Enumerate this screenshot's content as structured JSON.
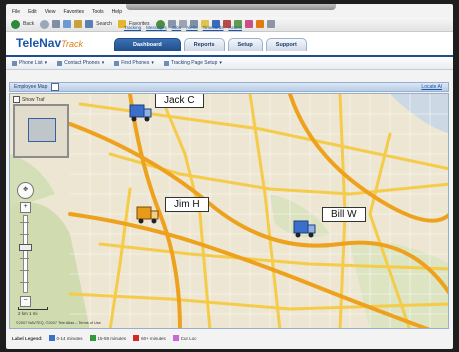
{
  "browser": {
    "menu": [
      "File",
      "Edit",
      "View",
      "Favorites",
      "Tools",
      "Help"
    ],
    "back_label": "Back",
    "search_label": "Search",
    "favorites_label": "Favorites"
  },
  "app": {
    "logo_main": "TeleNav",
    "logo_accent": "Track",
    "tabs": [
      {
        "label": "Dashboard",
        "active": true
      },
      {
        "label": "Reports"
      },
      {
        "label": "Setup"
      },
      {
        "label": "Support"
      }
    ],
    "subnav": [
      "Tracking",
      "Messages",
      "Jobs",
      "Alerts",
      "Timecards",
      "Assets"
    ]
  },
  "menu_bar": {
    "items": [
      "Phone List",
      "Contact Phones",
      "Find Phones",
      "Tracking Page Setup"
    ]
  },
  "panel": {
    "title": "Employee Map",
    "right_link": "Locate Al"
  },
  "map": {
    "show_traffic_label": "Show Traf",
    "scale_km": "2 km",
    "scale_mi": "1 mi",
    "copyright": "©2007 NAVTEQ, ©2007 Tele Atlas – Terms of Use",
    "markers": [
      {
        "name": "Jack C",
        "color": "#3b6fc9"
      },
      {
        "name": "Jim H",
        "color": "#e89a1a"
      },
      {
        "name": "Bill W",
        "color": "#3b6fc9"
      }
    ]
  },
  "legend": {
    "title": "Label Legend:",
    "items": [
      {
        "label": "0-14 minutes",
        "color": "#3b6fc9"
      },
      {
        "label": "15-59 minutes",
        "color": "#2e9a3c"
      },
      {
        "label": "60+ minutes",
        "color": "#d12a2a"
      },
      {
        "label": "Cur Loc",
        "color": "#c86ad1"
      }
    ]
  }
}
